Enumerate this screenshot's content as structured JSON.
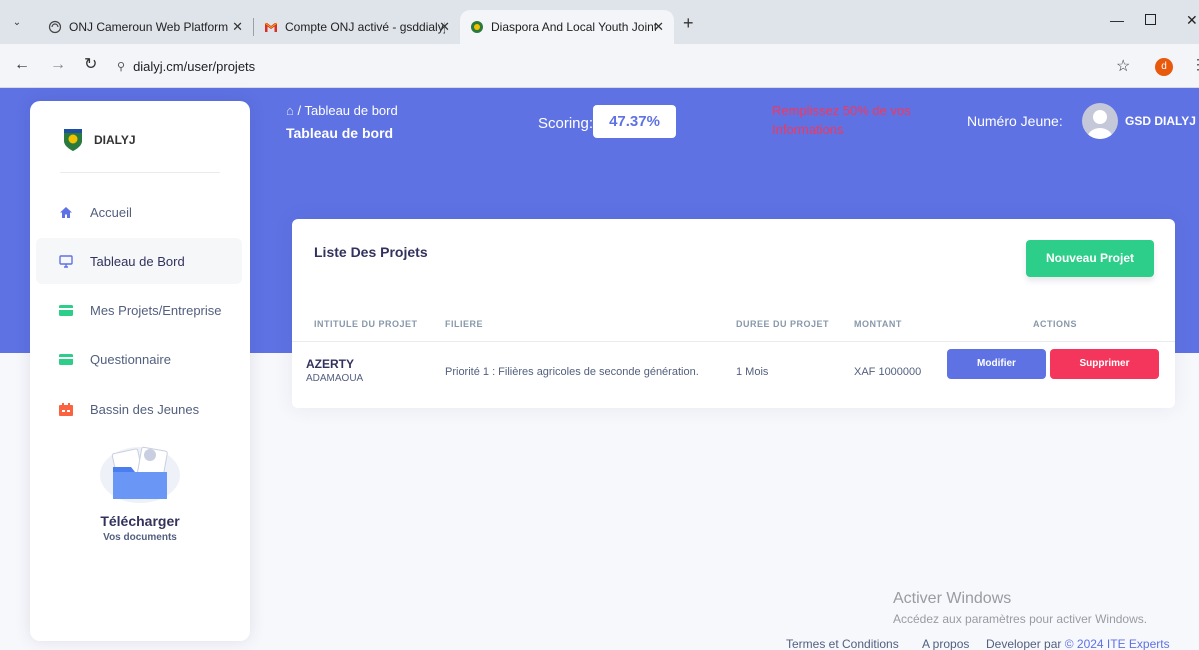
{
  "browser": {
    "tabs": [
      {
        "title": "ONJ Cameroun Web Platform",
        "favicon": "globe-icon",
        "active": false
      },
      {
        "title": "Compte ONJ activé - gsddialyj@",
        "favicon": "gmail-icon",
        "active": false
      },
      {
        "title": "Diaspora And Local Youth Joint",
        "favicon": "dialyj-logo",
        "active": true
      }
    ],
    "url": "dialyj.cm/user/projets",
    "profile_initial": "d"
  },
  "sidebar": {
    "brand": "DIALYJ",
    "items": [
      {
        "label": "Accueil",
        "icon": "home-icon",
        "active": false
      },
      {
        "label": "Tableau de Bord",
        "icon": "monitor-icon",
        "active": true
      },
      {
        "label": "Mes Projets/Entreprise",
        "icon": "card-icon",
        "active": false
      },
      {
        "label": "Questionnaire",
        "icon": "card-icon",
        "active": false
      },
      {
        "label": "Bassin des Jeunes",
        "icon": "calendar-icon",
        "active": false
      }
    ],
    "download": {
      "title": "Télécharger",
      "subtitle": "Vos documents"
    }
  },
  "header": {
    "breadcrumb": "Tableau de bord",
    "title": "Tableau de bord",
    "scoring_label": "Scoring:",
    "scoring_value": "47.37%",
    "warning": "Remplissez 50% de vos Informations",
    "numero_label": "Numéro Jeune:",
    "user_name": "GSD DIALYJ"
  },
  "projects": {
    "title": "Liste Des Projets",
    "new_button": "Nouveau Projet",
    "columns": [
      "INTITULE DU PROJET",
      "FILIERE",
      "DUREE DU PROJET",
      "MONTANT",
      "ACTIONS"
    ],
    "rows": [
      {
        "name": "AZERTY",
        "region": "ADAMAOUA",
        "filiere": "Priorité 1 : Filières agricoles de seconde génération.",
        "duree": "1 Mois",
        "montant": "XAF 1000000",
        "edit_label": "Modifier",
        "delete_label": "Supprimer"
      }
    ]
  },
  "watermark": {
    "title": "Activer Windows",
    "subtitle": "Accédez aux paramètres pour activer Windows."
  },
  "footer": {
    "terms": "Termes et Conditions",
    "about": "A propos",
    "developer_prefix": "Developer par",
    "developer_brand": "© 2024 ITE Experts"
  },
  "colors": {
    "primary": "#5e72e4",
    "success": "#2dce89",
    "danger": "#f5365c"
  }
}
